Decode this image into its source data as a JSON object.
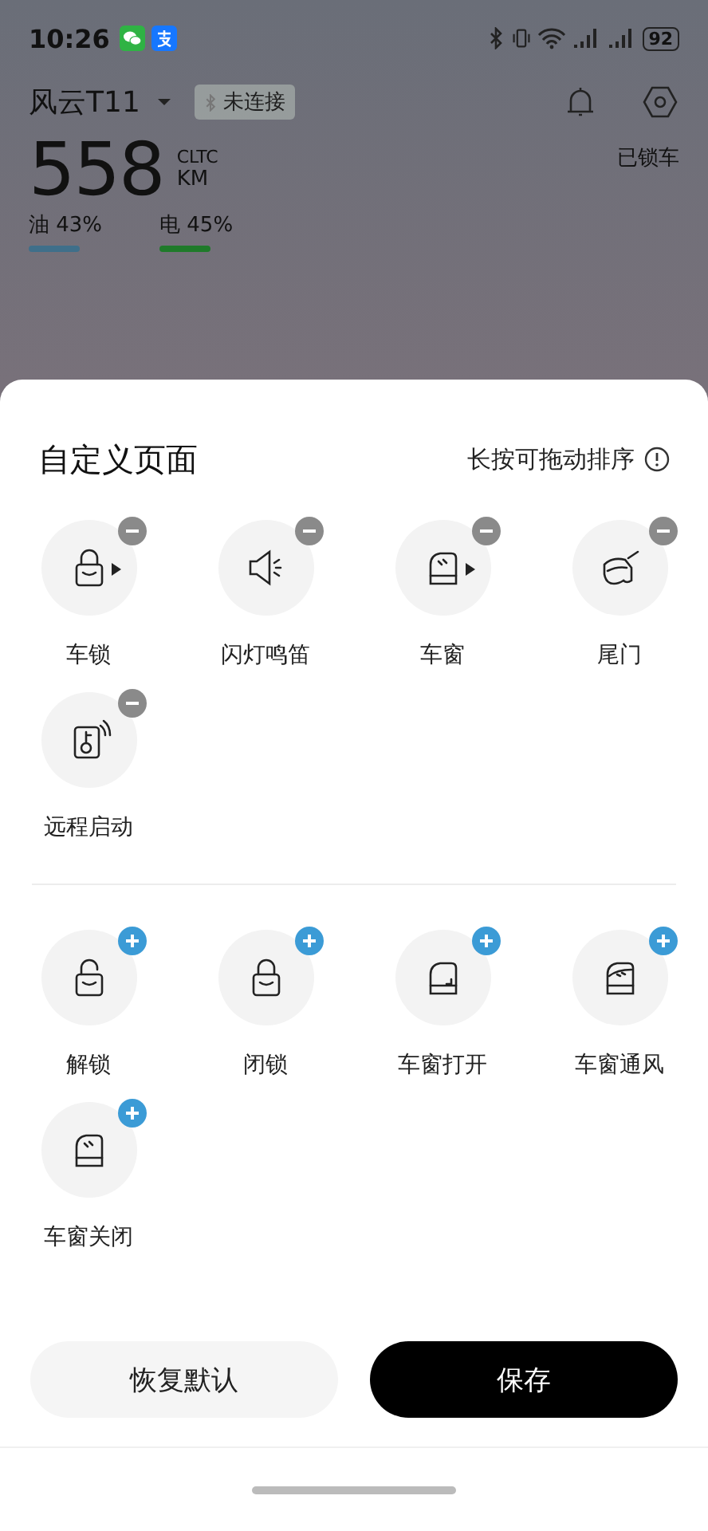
{
  "status_bar": {
    "time": "10:26",
    "battery": "92"
  },
  "vehicle": {
    "name": "风云T11",
    "connection": "未连接",
    "range": "558",
    "range_standard": "CLTC",
    "range_unit": "KM",
    "lock_status": "已锁车",
    "energy": [
      {
        "label": "油 43%",
        "color": "#3f6f8a"
      },
      {
        "label": "电 45%",
        "color": "#1f7a2a"
      }
    ]
  },
  "sheet": {
    "title": "自定义页面",
    "hint": "长按可拖动排序",
    "sections": [
      {
        "kind": "removable",
        "items": [
          {
            "label": "车锁",
            "kind": "lock",
            "arrow": true
          },
          {
            "label": "闪灯鸣笛",
            "kind": "horn",
            "arrow": false
          },
          {
            "label": "车窗",
            "kind": "window",
            "arrow": true
          },
          {
            "label": "尾门",
            "kind": "tailgate",
            "arrow": false
          },
          {
            "label": "远程启动",
            "kind": "remote",
            "arrow": false
          }
        ]
      },
      {
        "kind": "addable",
        "items": [
          {
            "label": "解锁",
            "kind": "unlock",
            "arrow": false
          },
          {
            "label": "闭锁",
            "kind": "lock",
            "arrow": false
          },
          {
            "label": "车窗打开",
            "kind": "window-open",
            "arrow": false
          },
          {
            "label": "车窗通风",
            "kind": "window-vent",
            "arrow": false
          },
          {
            "label": "车窗关闭",
            "kind": "window-close",
            "arrow": false
          }
        ]
      }
    ]
  },
  "buttons": [
    {
      "label": "恢复默认",
      "kind": "secondary"
    },
    {
      "label": "保存",
      "kind": "primary"
    }
  ]
}
